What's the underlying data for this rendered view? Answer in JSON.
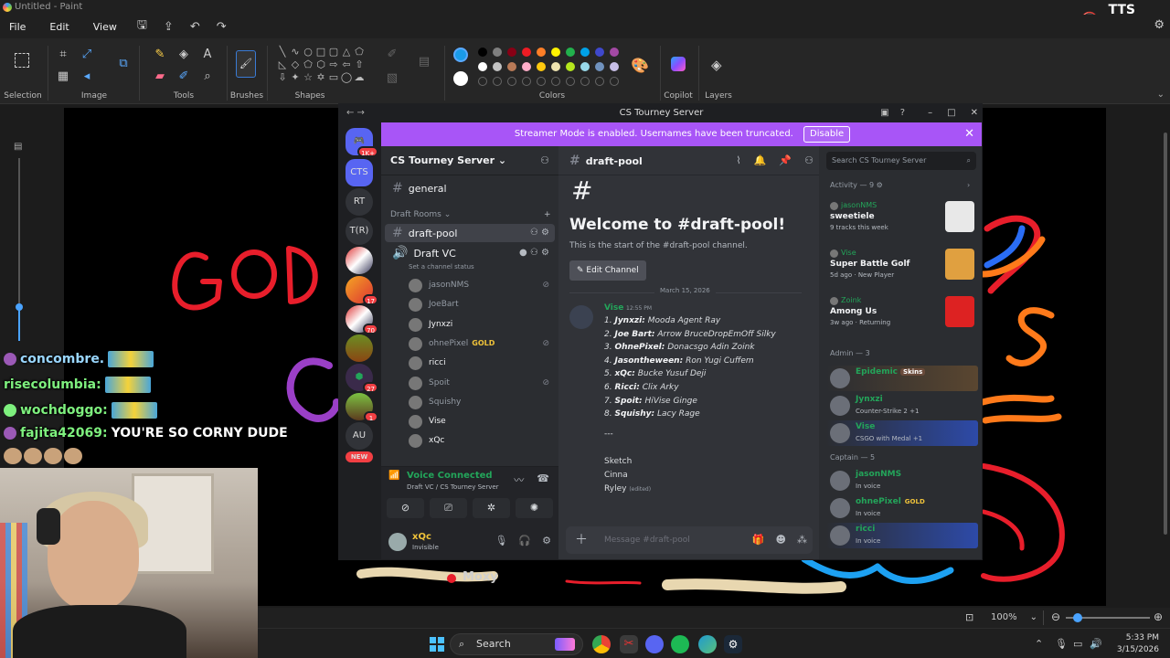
{
  "paint": {
    "window_title": "Untitled - Paint",
    "overlay_logo": "TTS",
    "menu": [
      "File",
      "Edit",
      "View"
    ],
    "ribbon_groups": [
      "Selection",
      "Image",
      "Tools",
      "Brushes",
      "Shapes",
      "Colors",
      "Copilot",
      "Layers"
    ],
    "zoom": "100%",
    "colors": {
      "row1": [
        "#000000",
        "#7f7f7f",
        "#880015",
        "#ed1c24",
        "#ff7f27",
        "#fff200",
        "#22b14c",
        "#00a2e8",
        "#3f48cc",
        "#a349a4"
      ],
      "row2": [
        "#ffffff",
        "#c3c3c3",
        "#b97a57",
        "#ffaec9",
        "#ffc90e",
        "#efe4b0",
        "#b5e61d",
        "#99d9ea",
        "#7092be",
        "#c8bfe7"
      ],
      "primary": "#1a9be8",
      "secondary": "#ffffff"
    }
  },
  "chat": [
    {
      "user": "concombre.",
      "user_color": "#9ad7ff",
      "message": ""
    },
    {
      "user": "risecolumbia:",
      "user_color": "#7ef07e",
      "message": ""
    },
    {
      "user": "wochdoggo:",
      "user_color": "#7ef07e",
      "message": ""
    },
    {
      "user": "fajita42069:",
      "user_color": "#7ef07e",
      "message": "YOU'RE SO CORNY DUDE"
    }
  ],
  "canvas_labels": {
    "god_text": "GOD",
    "moxy": "Moxy"
  },
  "discord": {
    "window_title": "CS Tourney Server",
    "banner": {
      "text": "Streamer Mode is enabled. Usernames have been truncated.",
      "button": "Disable"
    },
    "servers": [
      {
        "label": "",
        "badge": "1K+"
      },
      {
        "label": "CTS",
        "badge": ""
      },
      {
        "label": "RT",
        "badge": ""
      },
      {
        "label": "T(R)",
        "badge": ""
      },
      {
        "label": "",
        "badge": ""
      },
      {
        "label": "",
        "badge": "17"
      },
      {
        "label": "",
        "badge": "70"
      },
      {
        "label": "",
        "badge": ""
      },
      {
        "label": "",
        "badge": "27"
      },
      {
        "label": "",
        "badge": "1"
      },
      {
        "label": "AU",
        "badge": ""
      },
      {
        "label": "NEW",
        "badge": ""
      }
    ],
    "server_name": "CS Tourney Server",
    "channels": {
      "general": "general",
      "category": "Draft Rooms",
      "text_channel": "draft-pool",
      "voice_channel": "Draft VC",
      "voice_status": "Set a channel status"
    },
    "voice_users": [
      {
        "name": "jasonNMS",
        "tag": "",
        "muted": true,
        "white": false
      },
      {
        "name": "JoeBart",
        "tag": "",
        "muted": false,
        "white": false
      },
      {
        "name": "Jynxzi",
        "tag": "",
        "muted": false,
        "white": true
      },
      {
        "name": "ohnePixel",
        "tag": "GOLD",
        "muted": true,
        "white": false
      },
      {
        "name": "ricci",
        "tag": "",
        "muted": false,
        "white": true
      },
      {
        "name": "Spoit",
        "tag": "",
        "muted": true,
        "white": false
      },
      {
        "name": "Squishy",
        "tag": "",
        "muted": false,
        "white": false
      },
      {
        "name": "Vise",
        "tag": "",
        "muted": false,
        "white": true
      },
      {
        "name": "xQc",
        "tag": "",
        "muted": false,
        "white": true
      }
    ],
    "voice_panel": {
      "title": "Voice Connected",
      "subtitle": "Draft VC / CS Tourney Server",
      "user": "xQc",
      "status": "Invisible"
    },
    "main": {
      "channel": "draft-pool",
      "welcome": "Welcome to #draft-pool!",
      "start": "This is the start of the #draft-pool channel.",
      "edit_button": "Edit Channel",
      "date": "March 15, 2026",
      "composer_placeholder": "Message #draft-pool"
    },
    "message": {
      "author": "Vise",
      "time": "12:55 PM",
      "picks": [
        {
          "n": "1.",
          "captain": "Jynxzi:",
          "players": "Mooda Agent Ray"
        },
        {
          "n": "2.",
          "captain": "Joe Bart:",
          "players": "Arrow BruceDropEmOff Silky"
        },
        {
          "n": "3.",
          "captain": "OhnePixel:",
          "players": "Donacsgo Adin Zoink"
        },
        {
          "n": "4.",
          "captain": "Jasontheween:",
          "players": "Ron Yugi Cuffem"
        },
        {
          "n": "5.",
          "captain": "xQc:",
          "players": "Bucke Yusuf Deji"
        },
        {
          "n": "6.",
          "captain": "Ricci:",
          "players": "Clix Arky"
        },
        {
          "n": "7.",
          "captain": "Spoit:",
          "players": "HiVise Ginge"
        },
        {
          "n": "8.",
          "captain": "Squishy:",
          "players": "Lacy Rage"
        }
      ],
      "separator": "---",
      "extras": [
        "Sketch",
        "Cinna",
        "Ryley"
      ],
      "edited": "(edited)"
    },
    "search_placeholder": "Search CS Tourney Server",
    "activity": {
      "header": "Activity — 9",
      "items": [
        {
          "user": "jasonNMS",
          "title": "sweetiele",
          "sub": "9 tracks this week",
          "thumb": "#e8e8e8"
        },
        {
          "user": "Vise",
          "title": "Super Battle Golf",
          "sub": "5d ago · New Player",
          "thumb": "#e0a040"
        },
        {
          "user": "Zoink",
          "title": "Among Us",
          "sub": "3w ago · Returning",
          "thumb": "#d22"
        }
      ]
    },
    "admin": {
      "header": "Admin — 3",
      "members": [
        {
          "name": "Epidemic",
          "color": "#23a55a",
          "tag": "",
          "skins": "Skins",
          "status": "",
          "bg": "linear-gradient(90deg,#2b2d31,#5a4630)"
        },
        {
          "name": "Jynxzi",
          "color": "#23a55a",
          "tag": "",
          "skins": "",
          "status": "Counter-Strike 2 +1",
          "bg": "transparent"
        },
        {
          "name": "Vise",
          "color": "#23a55a",
          "tag": "",
          "skins": "",
          "status": "CSGO with Medal +1",
          "bg": "linear-gradient(90deg,#2b2d31,#2d4aa8)"
        }
      ]
    },
    "captain": {
      "header": "Captain — 5",
      "members": [
        {
          "name": "jasonNMS",
          "color": "#23a55a",
          "tag": "",
          "status": "In voice",
          "bg": "transparent"
        },
        {
          "name": "ohnePixel",
          "color": "#23a55a",
          "tag": "GOLD",
          "status": "In voice",
          "bg": "transparent"
        },
        {
          "name": "ricci",
          "color": "#23a55a",
          "tag": "",
          "status": "In voice",
          "bg": "linear-gradient(90deg,#2b2d31,#2d4aa8)"
        }
      ]
    }
  },
  "taskbar": {
    "search": "Search",
    "time": "5:33 PM",
    "date": "3/15/2026"
  }
}
